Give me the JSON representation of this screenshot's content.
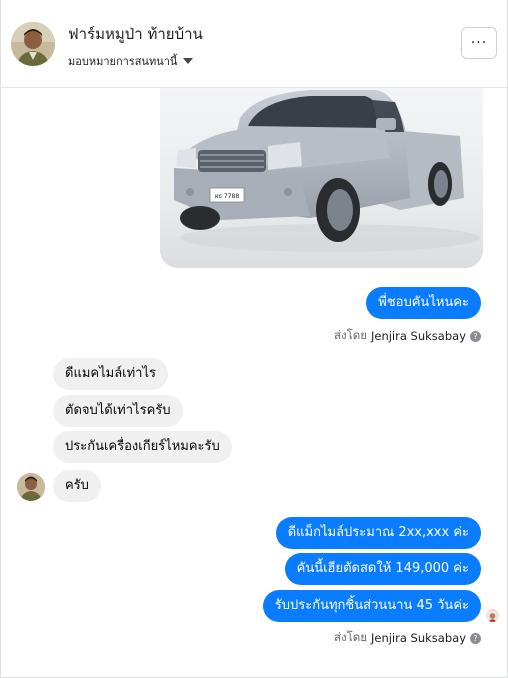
{
  "header": {
    "title": "ฟาร์มหมูป่า ท้ายบ้าน",
    "subtitle": "มอบหมายการสนทนานี้",
    "more_label": "···"
  },
  "image_message": {
    "plate_text": "ผธ 7788"
  },
  "messages": {
    "out1": "พี่ชอบคันไหนคะ",
    "in1": "ดีแมคไมล์เท่าไร",
    "in2": "ตัดจบได้เท่าไรครับ",
    "in3": "ประกันเครื่องเกียร์ไหมคะรับ",
    "in4": "ครับ",
    "out2": "ดีแม็กไมล์ประมาณ 2xx,xxx ค่ะ",
    "out3": "คันนี้เฮียตัดสดให้ 149,000 ค่ะ",
    "out4": "รับประกันทุกชิ้นส่วนนาน 45 วันค่ะ"
  },
  "sent_by": {
    "prefix": "ส่งโดย",
    "name": "Jenjira Suksabay",
    "info": "?"
  },
  "colors": {
    "outgoing": "#0a7cff",
    "incoming": "#f0f0f0"
  }
}
